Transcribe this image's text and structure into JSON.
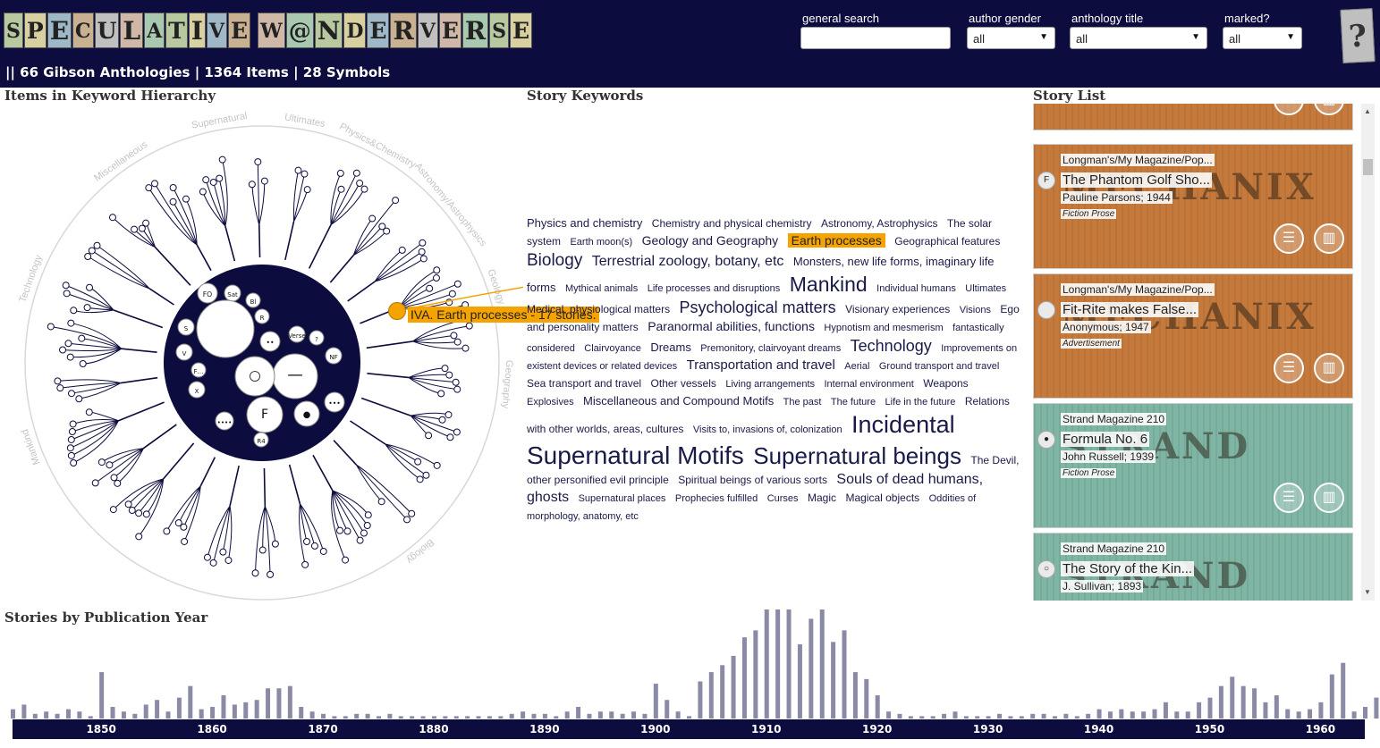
{
  "header": {
    "logo_letters": [
      "S",
      "P",
      "E",
      "C",
      "U",
      "L",
      "A",
      "T",
      "I",
      "V",
      "E",
      " ",
      "W",
      "@",
      "N",
      "D",
      "E",
      "R",
      "V",
      "E",
      "R",
      "S",
      "E"
    ],
    "summary": "|| 66 Gibson Anthologies | 1364 Items | 28 Symbols",
    "filters": {
      "search_label": "general search",
      "search_value": "",
      "gender_label": "author gender",
      "gender_value": "all",
      "anthology_label": "anthology title",
      "anthology_value": "all",
      "marked_label": "marked?",
      "marked_value": "all"
    },
    "help_icon": "?"
  },
  "sections": {
    "hierarchy": "Items in Keyword Hierarchy",
    "keywords": "Story Keywords",
    "stories": "Story List",
    "timeline": "Stories by Publication Year"
  },
  "hierarchy": {
    "categories": [
      "Supernatural",
      "Ultimates",
      "Physics&Chemistry",
      "Astronomy/Astrophysics",
      "Geology",
      "Geography",
      "Biology",
      "Mankind",
      "Technology",
      "Miscellaneous"
    ],
    "symbols": [
      "F",
      "FO",
      "Sat",
      "Bl",
      "R",
      "S",
      "V",
      "F…",
      "X",
      "Verse",
      "?",
      "NF",
      "R4",
      "••••",
      "••",
      "•••",
      "—",
      "○",
      "●"
    ],
    "tooltip": "IVA. Earth processes - 17 stories."
  },
  "keywords": [
    {
      "t": "Physics and chemistry",
      "s": 13
    },
    {
      "t": "Chemistry and physical chemistry",
      "s": 12
    },
    {
      "t": "Astronomy, Astrophysics",
      "s": 12
    },
    {
      "t": "The solar system",
      "s": 12
    },
    {
      "t": "Earth moon(s)",
      "s": 11
    },
    {
      "t": "Geology and Geography",
      "s": 14
    },
    {
      "t": "Earth processes",
      "s": 14,
      "hl": true
    },
    {
      "t": "Geographical features",
      "s": 12
    },
    {
      "t": "Biology",
      "s": 19
    },
    {
      "t": "Terrestrial zoology, botany, etc",
      "s": 16
    },
    {
      "t": "Monsters, new life forms, imaginary life forms",
      "s": 13
    },
    {
      "t": "Mythical animals",
      "s": 11
    },
    {
      "t": "Life processes and disruptions",
      "s": 11
    },
    {
      "t": "Mankind",
      "s": 23
    },
    {
      "t": "Individual humans",
      "s": 11
    },
    {
      "t": "Ultimates",
      "s": 11
    },
    {
      "t": "Medical, physiological matters",
      "s": 12
    },
    {
      "t": "Psychological matters",
      "s": 18
    },
    {
      "t": "Visionary experiences",
      "s": 12
    },
    {
      "t": "Visions",
      "s": 11
    },
    {
      "t": "Ego and personality matters",
      "s": 12
    },
    {
      "t": "Paranormal abilities, functions",
      "s": 14
    },
    {
      "t": "Hypnotism and mesmerism",
      "s": 11
    },
    {
      "t": "fantastically considered",
      "s": 11
    },
    {
      "t": "Clairvoyance",
      "s": 11
    },
    {
      "t": "Dreams",
      "s": 13
    },
    {
      "t": "Premonitory, clairvoyant dreams",
      "s": 11
    },
    {
      "t": "Technology",
      "s": 18
    },
    {
      "t": "Improvements on existent devices or related devices",
      "s": 11
    },
    {
      "t": "Transportation and travel",
      "s": 15
    },
    {
      "t": "Aerial",
      "s": 11
    },
    {
      "t": "Ground transport and travel",
      "s": 11
    },
    {
      "t": "Sea transport and travel",
      "s": 12
    },
    {
      "t": "Other vessels",
      "s": 12
    },
    {
      "t": "Living arrangements",
      "s": 11
    },
    {
      "t": "Internal environment",
      "s": 11
    },
    {
      "t": "Weapons",
      "s": 12
    },
    {
      "t": "Explosives",
      "s": 11
    },
    {
      "t": "Miscellaneous and Compound Motifs",
      "s": 13
    },
    {
      "t": "The past",
      "s": 11
    },
    {
      "t": "The future",
      "s": 11
    },
    {
      "t": "Life in the future",
      "s": 11
    },
    {
      "t": "Relations with other worlds, areas, cultures",
      "s": 12
    },
    {
      "t": "Visits to, invasions of, colonization",
      "s": 11
    },
    {
      "t": "Incidental",
      "s": 27
    },
    {
      "t": "Supernatural Motifs",
      "s": 28
    },
    {
      "t": "Supernatural beings",
      "s": 26
    },
    {
      "t": "The Devil, other personified evil principle",
      "s": 12
    },
    {
      "t": "Spiritual beings of various sorts",
      "s": 12
    },
    {
      "t": "Souls of dead humans, ghosts",
      "s": 16
    },
    {
      "t": "Supernatural places",
      "s": 11
    },
    {
      "t": "Prophecies fulfilled",
      "s": 11
    },
    {
      "t": "Curses",
      "s": 11
    },
    {
      "t": "Magic",
      "s": 12
    },
    {
      "t": "Magical objects",
      "s": 12
    },
    {
      "t": "Oddities of morphology, anatomy, etc",
      "s": 11
    }
  ],
  "stories": [
    {
      "anthology": "",
      "title": "",
      "author": "",
      "genre": "",
      "symbol": "",
      "bg": "#c57a3c",
      "mag": "MECHANIX"
    },
    {
      "anthology": "Longman's/My Magazine/Pop...",
      "title": "The Phantom Golf Sho...",
      "author": "Pauline Parsons; 1944",
      "genre": "Fiction Prose",
      "symbol": "F",
      "bg": "#c57a3c",
      "mag": "MECHANIX"
    },
    {
      "anthology": "Longman's/My Magazine/Pop...",
      "title": "Fit-Rite makes False...",
      "author": "Anonymous; 1947",
      "genre": "Advertisement",
      "symbol": "",
      "bg": "#c57a3c",
      "mag": "MECHANIX"
    },
    {
      "anthology": "Strand Magazine 210",
      "title": "Formula No. 6",
      "author": "John Russell; 1939",
      "genre": "Fiction Prose",
      "symbol": "●",
      "bg": "#7fb5a4",
      "mag": "STRAND"
    },
    {
      "anthology": "Strand Magazine 210",
      "title": "The Story of the Kin...",
      "author": "J. Sullivan; 1893",
      "genre": "",
      "symbol": "○",
      "bg": "#7fb5a4",
      "mag": "STRAND"
    }
  ],
  "timeline": {
    "year_start": 1842,
    "year_end": 1964,
    "ticks": [
      "1850",
      "1860",
      "1870",
      "1880",
      "1890",
      "1900",
      "1910",
      "1920",
      "1930",
      "1940",
      "1950",
      "1960"
    ],
    "counts": [
      4,
      6,
      2,
      3,
      2,
      4,
      3,
      1,
      20,
      5,
      3,
      2,
      6,
      8,
      3,
      9,
      14,
      4,
      5,
      10,
      6,
      7,
      8,
      13,
      13,
      14,
      5,
      3,
      2,
      1,
      1,
      2,
      2,
      1,
      2,
      1,
      1,
      1,
      1,
      1,
      1,
      1,
      1,
      1,
      1,
      2,
      3,
      2,
      2,
      1,
      3,
      5,
      2,
      3,
      3,
      2,
      3,
      2,
      15,
      8,
      3,
      1,
      16,
      20,
      23,
      27,
      35,
      38,
      47,
      47,
      47,
      32,
      43,
      47,
      33,
      38,
      20,
      17,
      10,
      3,
      2,
      1,
      1,
      1,
      2,
      3,
      1,
      1,
      1,
      2,
      1,
      1,
      2,
      2,
      1,
      2,
      1,
      2,
      4,
      3,
      4,
      3,
      3,
      4,
      7,
      3,
      3,
      7,
      9,
      14,
      18,
      14,
      13,
      7,
      10,
      4,
      3,
      4,
      7,
      19,
      24,
      3,
      5,
      9,
      2,
      2,
      2,
      4,
      1,
      2
    ]
  }
}
